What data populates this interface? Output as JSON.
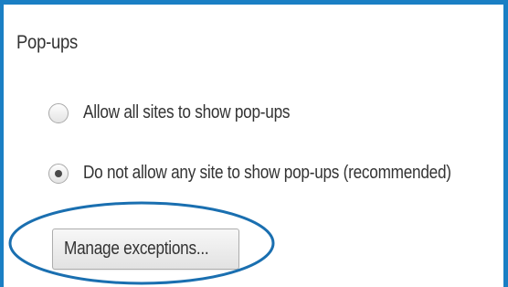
{
  "section": {
    "title": "Pop-ups"
  },
  "options": [
    {
      "label": "Allow all sites to show pop-ups",
      "checked": false
    },
    {
      "label": "Do not allow any site to show pop-ups (recommended)",
      "checked": true
    }
  ],
  "manage_button": {
    "label": "Manage exceptions..."
  },
  "colors": {
    "frame_border": "#1a7fc4",
    "highlight_ellipse": "#1a6fb0"
  }
}
